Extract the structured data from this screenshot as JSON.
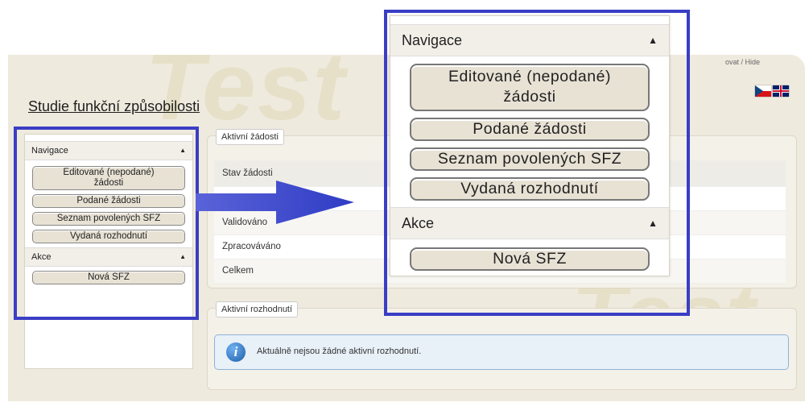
{
  "app": {
    "watermark": "Test",
    "topbar_text": "ovat / Hide",
    "page_title": "Studie funkční způsobilosti",
    "flags": [
      "cz-flag-icon",
      "uk-flag-icon"
    ]
  },
  "navigation": {
    "header": "Navigace",
    "collapse_icon": "▲",
    "items": [
      {
        "line1": "Editované (nepodané)",
        "line2": "žádosti"
      },
      {
        "line1": "Podané žádosti",
        "line2": ""
      },
      {
        "line1": "Seznam povolených SFZ",
        "line2": ""
      },
      {
        "line1": "Vydaná rozhodnutí",
        "line2": ""
      }
    ],
    "actions_header": "Akce",
    "actions": [
      {
        "line1": "Nová SFZ"
      }
    ]
  },
  "active_requests": {
    "tab_label": "Aktivní žádosti",
    "header": "Stav žádosti",
    "rows": [
      "Validováno",
      "Zpracováváno",
      "Celkem"
    ]
  },
  "active_decisions": {
    "tab_label": "Aktivní rozhodnutí",
    "message": "Aktuálně nejsou žádné aktivní rozhodnutí."
  },
  "colors": {
    "highlight": "#3a3ec4",
    "arrow": "#3b46c9",
    "page_bg": "#efeade"
  }
}
